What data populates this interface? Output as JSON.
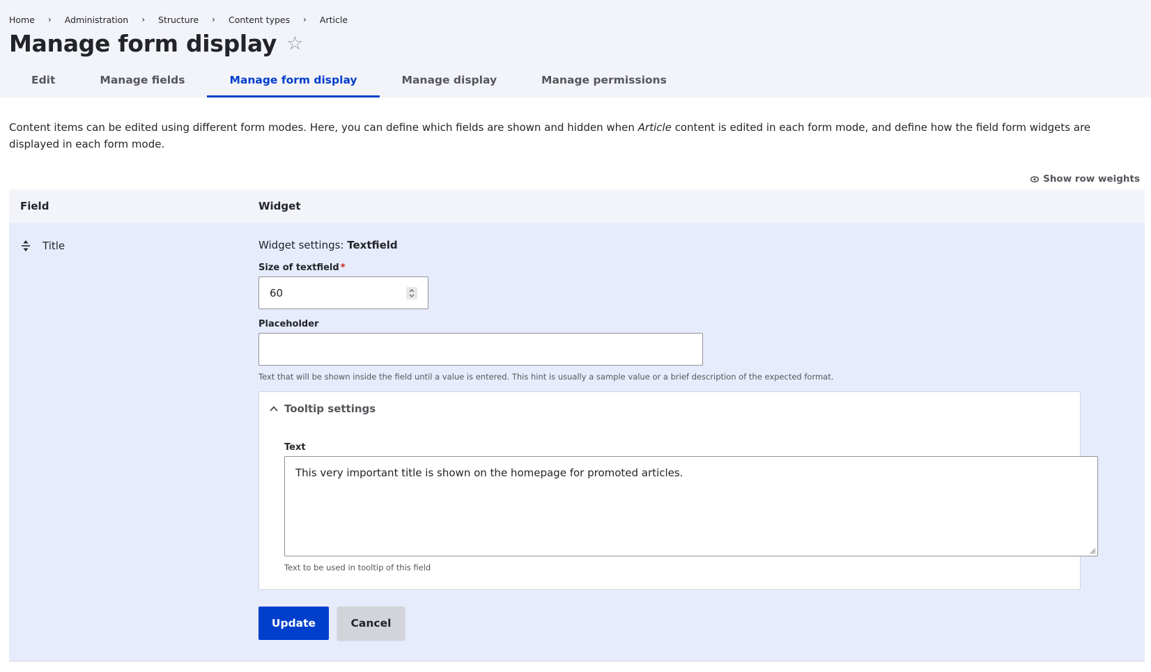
{
  "breadcrumb": [
    "Home",
    "Administration",
    "Structure",
    "Content types",
    "Article"
  ],
  "breadcrumb_separator": "›",
  "page_title": "Manage form display",
  "star_glyph": "☆",
  "tabs": [
    {
      "label": "Edit"
    },
    {
      "label": "Manage fields"
    },
    {
      "label": "Manage form display",
      "active": true
    },
    {
      "label": "Manage display"
    },
    {
      "label": "Manage permissions"
    }
  ],
  "intro": {
    "before": "Content items can be edited using different form modes. Here, you can define which fields are shown and hidden when ",
    "em": "Article",
    "after": " content is edited in each form mode, and define how the field form widgets are displayed in each form mode."
  },
  "row_weights_label": "Show row weights",
  "table": {
    "headers": {
      "field": "Field",
      "widget": "Widget"
    },
    "row": {
      "field_name": "Title",
      "widget_settings_prefix": "Widget settings: ",
      "widget_name": "Textfield",
      "size_label": "Size of textfield",
      "required_marker": "*",
      "size_value": "60",
      "placeholder_label": "Placeholder",
      "placeholder_value": "",
      "placeholder_help": "Text that will be shown inside the field until a value is entered. This hint is usually a sample value or a brief description of the expected format.",
      "tooltip_summary": "Tooltip settings",
      "tooltip_text_label": "Text",
      "tooltip_text_value": "This very important title is shown on the homepage for promoted articles.",
      "tooltip_help": "Text to be used in tooltip of this field",
      "update_label": "Update",
      "cancel_label": "Cancel"
    }
  },
  "colors": {
    "accent": "#003ecc",
    "header_bg": "#f3f4f9",
    "row_bg": "#e6ecfb",
    "required": "#d72222"
  }
}
